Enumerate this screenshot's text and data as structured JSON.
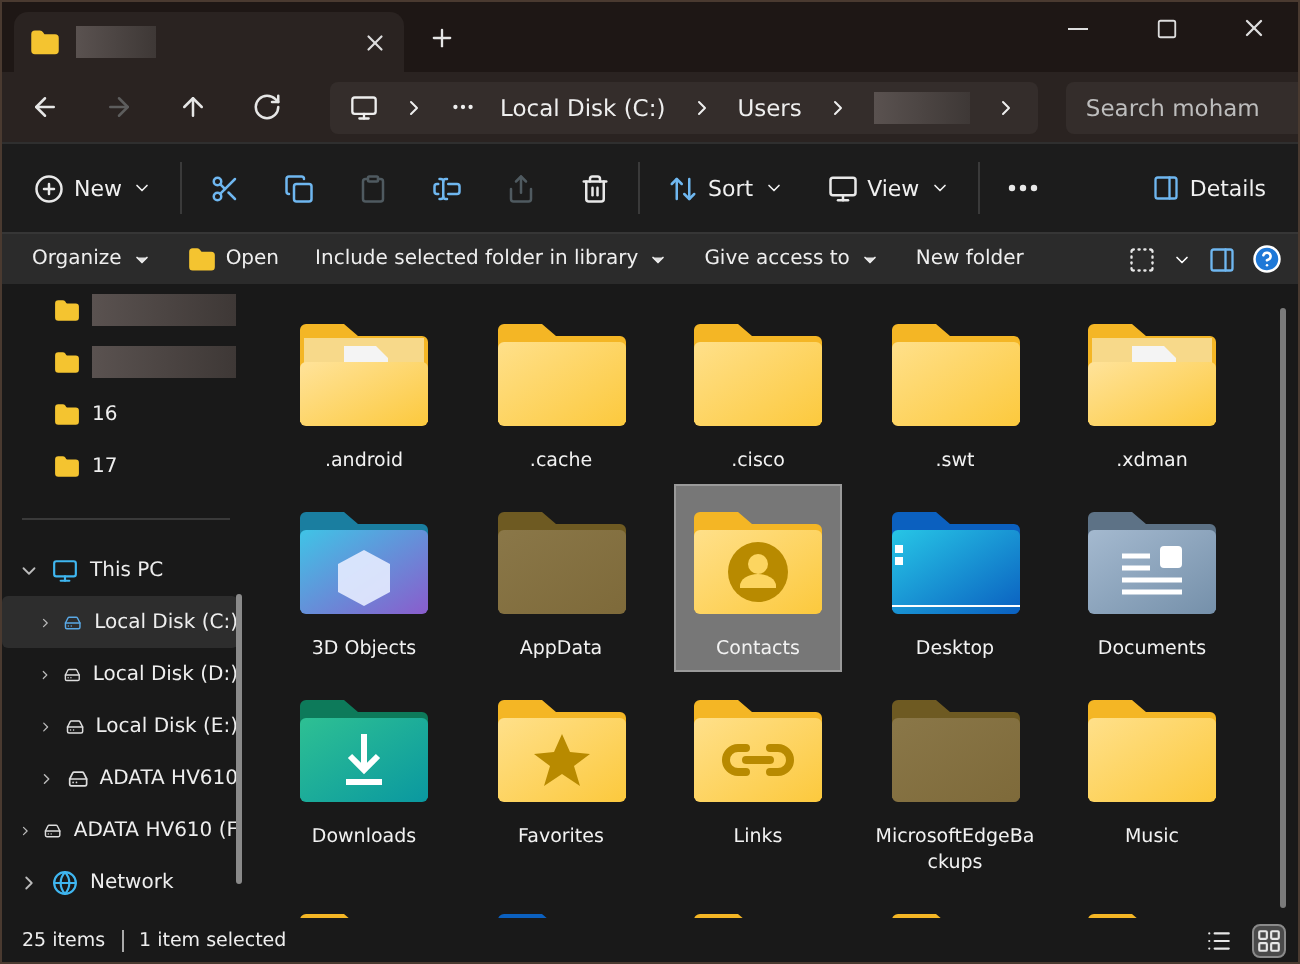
{
  "nav": [
    {
      "kind": "back",
      "disabled": false
    },
    {
      "kind": "forward",
      "disabled": true
    },
    {
      "kind": "up",
      "disabled": false
    },
    {
      "kind": "refresh",
      "disabled": false
    }
  ],
  "breadcrumb": [
    {
      "kind": "text",
      "label": "Local Disk (C:)"
    },
    {
      "kind": "text",
      "label": "Users"
    },
    {
      "kind": "redacted"
    }
  ],
  "search": {
    "placeholder": "Search moham"
  },
  "commands": [
    {
      "kind": "new",
      "label": "New",
      "disabled": false
    },
    {
      "kind": "cut",
      "disabled": false
    },
    {
      "kind": "copy",
      "disabled": false
    },
    {
      "kind": "paste",
      "disabled": true
    },
    {
      "kind": "rename",
      "disabled": false
    },
    {
      "kind": "share",
      "disabled": true
    },
    {
      "kind": "delete",
      "disabled": false
    },
    {
      "kind": "sort",
      "label": "Sort",
      "disabled": false
    },
    {
      "kind": "view",
      "label": "View",
      "disabled": false
    },
    {
      "kind": "more",
      "disabled": false
    }
  ],
  "details_button": {
    "label": "Details"
  },
  "classic_toolbar": [
    {
      "kind": "plain",
      "label": "Organize",
      "dropdown": true
    },
    {
      "kind": "folder",
      "label": "Open",
      "dropdown": false
    },
    {
      "kind": "plain",
      "label": "Include selected folder in library",
      "dropdown": true
    },
    {
      "kind": "plain",
      "label": "Give access to",
      "dropdown": true
    },
    {
      "kind": "plain",
      "label": "New folder",
      "dropdown": false
    }
  ],
  "sidebar": {
    "quick": [
      {
        "kind": "redacted"
      },
      {
        "kind": "redacted"
      },
      {
        "kind": "text",
        "label": "16"
      },
      {
        "kind": "text",
        "label": "17"
      }
    ],
    "tree": [
      {
        "kind": "pc",
        "label": "This PC",
        "expanded": true,
        "selected": false,
        "children": [
          {
            "kind": "system-drive",
            "label": "Local Disk (C:)",
            "expanded": false,
            "selected": true
          },
          {
            "kind": "drive",
            "label": "Local Disk (D:)",
            "expanded": false,
            "selected": false
          },
          {
            "kind": "drive",
            "label": "Local Disk (E:)",
            "expanded": false,
            "selected": false
          },
          {
            "kind": "drive",
            "label": "ADATA HV610",
            "expanded": false,
            "selected": false
          }
        ]
      },
      {
        "kind": "drive",
        "label": "ADATA HV610 (F",
        "expanded": false,
        "selected": false
      },
      {
        "kind": "network",
        "label": "Network",
        "expanded": false,
        "selected": false
      }
    ]
  },
  "files": [
    {
      "kind": "document",
      "name": ".android",
      "selected": false
    },
    {
      "kind": "plain",
      "name": ".cache",
      "selected": false
    },
    {
      "kind": "plain",
      "name": ".cisco",
      "selected": false
    },
    {
      "kind": "plain",
      "name": ".swt",
      "selected": false
    },
    {
      "kind": "document",
      "name": ".xdman",
      "selected": false
    },
    {
      "kind": "cube",
      "name": "3D Objects",
      "selected": false
    },
    {
      "kind": "hidden",
      "name": "AppData",
      "selected": false
    },
    {
      "kind": "contacts",
      "name": "Contacts",
      "selected": true
    },
    {
      "kind": "desktop",
      "name": "Desktop",
      "selected": false
    },
    {
      "kind": "documents",
      "name": "Documents",
      "selected": false
    },
    {
      "kind": "downloads",
      "name": "Downloads",
      "selected": false
    },
    {
      "kind": "favorites",
      "name": "Favorites",
      "selected": false
    },
    {
      "kind": "links",
      "name": "Links",
      "selected": false
    },
    {
      "kind": "hidden",
      "name": "MicrosoftEdgeBackups",
      "selected": false
    },
    {
      "kind": "plain",
      "name": "Music",
      "selected": false
    },
    {
      "kind": "plain"
    },
    {
      "kind": "blue"
    },
    {
      "kind": "plain"
    },
    {
      "kind": "plain"
    },
    {
      "kind": "plain"
    }
  ],
  "status": {
    "count": "25 items",
    "selection": "1 item selected"
  },
  "views": [
    {
      "kind": "details",
      "selected": false
    },
    {
      "kind": "icons",
      "selected": true
    }
  ]
}
